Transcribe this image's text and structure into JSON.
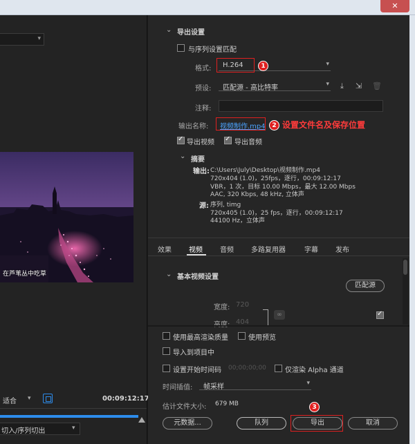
{
  "window": {
    "close_glyph": "✕"
  },
  "preview": {
    "caption": "在芦苇丛中吃草",
    "fit_label": "适合",
    "timecode": "00:09:12:17",
    "range_label": "切入/序列切出"
  },
  "export_settings": {
    "section_title": "导出设置",
    "match_sequence_label": "与序列设置匹配",
    "format_label": "格式:",
    "format_value": "H.264",
    "preset_label": "预设:",
    "preset_value": "匹配源 - 高比特率",
    "comment_label": "注释:",
    "comment_value": "",
    "output_name_label": "输出名称:",
    "output_name_value": "视频制作.mp4",
    "export_video_label": "导出视频",
    "export_audio_label": "导出音频",
    "annotation_text": "设置文件名及保存位置",
    "badges": [
      "1",
      "2",
      "3"
    ]
  },
  "summary": {
    "title": "摘要",
    "output_label": "输出:",
    "output_lines": [
      "C:\\Users\\July\\Desktop\\视频制作.mp4",
      "720x404 (1.0)，25fps，逐行，00:09:12:17",
      "VBR，1 次，目标 10.00 Mbps，最大 12.00 Mbps",
      "AAC, 320 Kbps, 48 kHz, 立体声"
    ],
    "source_label": "源:",
    "source_lines": [
      "序列, timg",
      "720x405 (1.0)，25 fps，逐行，00:09:12:17",
      "44100 Hz，立体声"
    ]
  },
  "tabs": [
    "效果",
    "视频",
    "音频",
    "多路复用器",
    "字幕",
    "发布"
  ],
  "video_settings": {
    "section_title": "基本视频设置",
    "match_source_button": "匹配源",
    "width_label": "宽度:",
    "width_value": "720",
    "height_label": "高度:",
    "height_value": "404"
  },
  "bottom": {
    "max_render_quality": "使用最高渲染质量",
    "use_previews": "使用预览",
    "import_into_project": "导入到项目中",
    "set_start_timecode": "设置开始时间码",
    "start_timecode_value": "00;00;00;00",
    "render_alpha_only": "仅渲染 Alpha 通道",
    "time_interpolation_label": "时间插值:",
    "time_interpolation_value": "帧采样",
    "estimated_size_label": "估计文件大小:",
    "estimated_size_value": "679 MB",
    "metadata_button": "元数据...",
    "queue_button": "队列",
    "export_button": "导出",
    "cancel_button": "取消"
  },
  "colors": {
    "accent_blue": "#2d8ceb",
    "annotation_red": "#e02020"
  }
}
